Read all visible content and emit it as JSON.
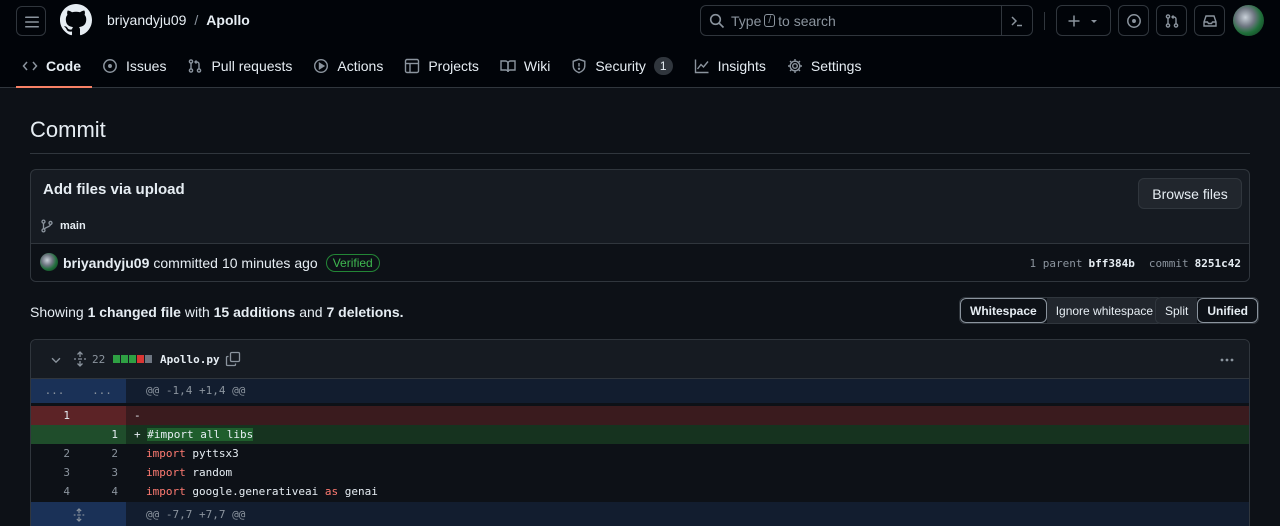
{
  "repo": {
    "owner": "briyandyju09",
    "separator": "/",
    "name": "Apollo"
  },
  "search": {
    "prefix": "Type",
    "key": "/",
    "suffix": "to search"
  },
  "tabs": [
    {
      "label": "Code"
    },
    {
      "label": "Issues"
    },
    {
      "label": "Pull requests"
    },
    {
      "label": "Actions"
    },
    {
      "label": "Projects"
    },
    {
      "label": "Wiki"
    },
    {
      "label": "Security",
      "count": "1"
    },
    {
      "label": "Insights"
    },
    {
      "label": "Settings"
    }
  ],
  "page": {
    "title": "Commit"
  },
  "commit": {
    "message": "Add files via upload",
    "browse_label": "Browse files",
    "branch": "main",
    "author": "briyandyju09",
    "action": "committed",
    "time": "10 minutes ago",
    "verified": "Verified",
    "parent_label": "1 parent",
    "parent_sha": "bff384b",
    "commit_label": "commit",
    "commit_sha": "8251c42"
  },
  "stats": {
    "showing": "Showing",
    "files": "1 changed file",
    "with": "with",
    "additions": "15 additions",
    "and": "and",
    "deletions": "7 deletions."
  },
  "view_options": {
    "whitespace": "Whitespace",
    "ignore_whitespace": "Ignore whitespace",
    "split": "Split",
    "unified": "Unified"
  },
  "file": {
    "change_count": "22",
    "name": "Apollo.py",
    "colors": {
      "add": "#2ea043",
      "del": "#da3633",
      "neutral": "#6e7681"
    }
  },
  "diff": {
    "hunk1": {
      "old": "...",
      "new": "...",
      "text": "@@ -1,4 +1,4 @@"
    },
    "del1": {
      "old": "1",
      "new": "",
      "text": "-"
    },
    "add1": {
      "old": "",
      "new": "1",
      "prefix": "+",
      "text": "#import all libs"
    },
    "ctx2": {
      "old": "2",
      "new": "2",
      "kw": "import",
      "rest": " pyttsx3"
    },
    "ctx3": {
      "old": "3",
      "new": "3",
      "kw": "import",
      "rest": " random"
    },
    "ctx4": {
      "old": "4",
      "new": "4",
      "kw": "import",
      "rest": " google.generativeai ",
      "kw2": "as",
      "rest2": " genai"
    },
    "hunk2": {
      "text": "@@ -7,7 +7,7 @@"
    }
  }
}
